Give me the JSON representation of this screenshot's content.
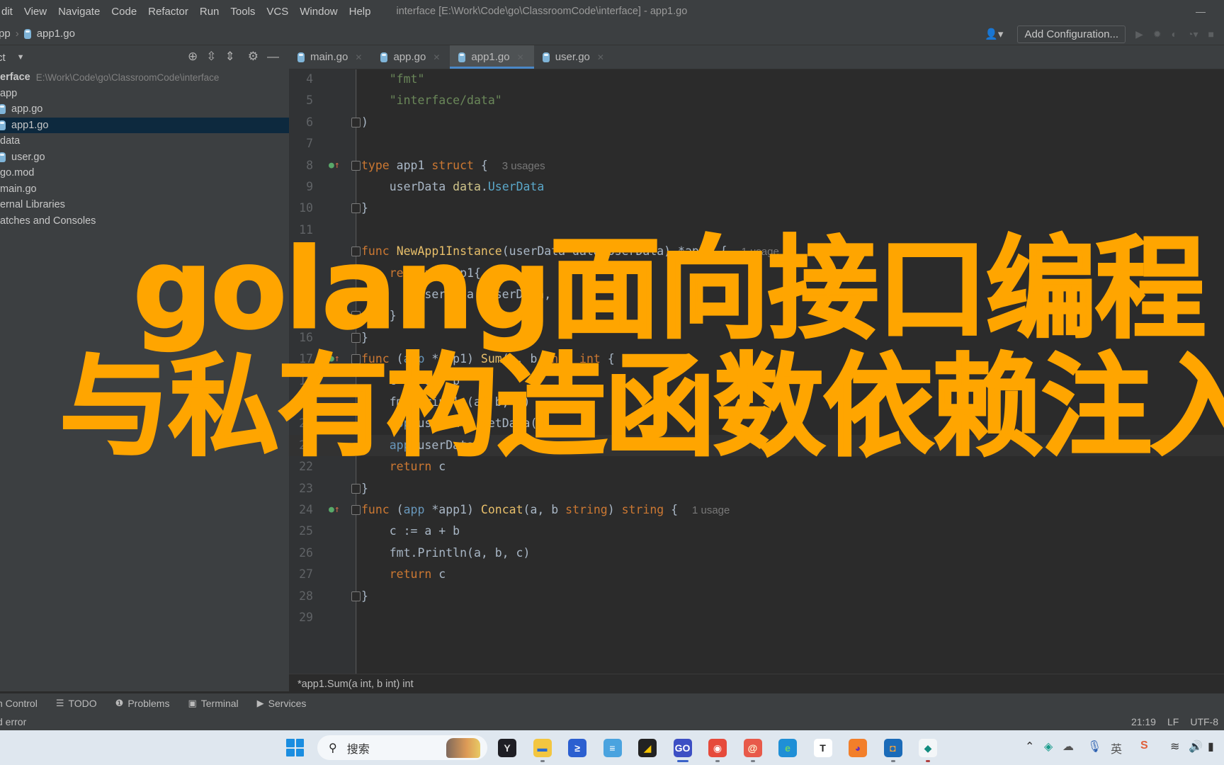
{
  "menubar": {
    "items": [
      "Edit",
      "View",
      "Navigate",
      "Code",
      "Refactor",
      "Run",
      "Tools",
      "VCS",
      "Window",
      "Help"
    ],
    "visible_items": [
      "dit",
      "View",
      "Navigate",
      "Code",
      "Refactor",
      "Run",
      "Tools",
      "VCS",
      "Window",
      "Help"
    ],
    "window_title": "interface [E:\\Work\\Code\\go\\ClassroomCode\\interface] - app1.go",
    "minimize": "—"
  },
  "navbar": {
    "breadcrumb": [
      "pp",
      "app1.go"
    ],
    "add_configuration": "Add Configuration...",
    "user_icon": "👤▾"
  },
  "project_panel": {
    "title": "ct",
    "tree": [
      {
        "label": "erface",
        "path": "E:\\Work\\Code\\go\\ClassroomCode\\interface",
        "indent": 0,
        "bold": true
      },
      {
        "label": "app",
        "indent": 0
      },
      {
        "label": "app.go",
        "indent": 0,
        "gofile": true
      },
      {
        "label": "app1.go",
        "indent": 0,
        "gofile": true,
        "selected": true
      },
      {
        "label": "data",
        "indent": 0
      },
      {
        "label": "user.go",
        "indent": 0,
        "gofile": true
      },
      {
        "label": "go.mod",
        "indent": 0
      },
      {
        "label": "main.go",
        "indent": 0
      },
      {
        "label": "ernal Libraries",
        "indent": 0
      },
      {
        "label": "atches and Consoles",
        "indent": 0
      }
    ]
  },
  "editor_tabs": [
    {
      "label": "main.go",
      "active": false
    },
    {
      "label": "app.go",
      "active": false
    },
    {
      "label": "app1.go",
      "active": true
    },
    {
      "label": "user.go",
      "active": false
    }
  ],
  "editor": {
    "lines": [
      {
        "n": "4",
        "html": "    <span class='str'>\"fmt\"</span>"
      },
      {
        "n": "5",
        "html": "    <span class='str'>\"interface/data\"</span>"
      },
      {
        "n": "6",
        "html": ")",
        "fold": true
      },
      {
        "n": "7",
        "html": ""
      },
      {
        "n": "8",
        "html": "<span class='kw'>type</span> app1 <span class='kw'>struct</span> {  <span class='hint'>3 usages</span>",
        "fold": true,
        "impl": true
      },
      {
        "n": "9",
        "html": "    userData <span class='pkg'>data</span>.<span class='ty'>UserData</span>"
      },
      {
        "n": "10",
        "html": "}",
        "fold": true
      },
      {
        "n": "11",
        "html": ""
      },
      {
        "n": "12",
        "html": "<span class='kw'>func</span> <span class='fnname'>NewApp1Instance</span>(userData data.UserData) *app1 {  <span class='hint'>1 usage</span>",
        "fold": true
      },
      {
        "n": "13",
        "html": "    <span class='kw'>return</span> &amp;app1{",
        "fold": true
      },
      {
        "n": "14",
        "html": "        userData: userData,"
      },
      {
        "n": "15",
        "html": "    }",
        "fold": true
      },
      {
        "n": "16",
        "html": "}",
        "fold": true
      },
      {
        "n": "17",
        "html": "<span class='kw'>func</span> (<span class='rcv'>app</span> *app1) <span class='fnname'>Sum</span>(a, b <span class='kw'>int</span>) <span class='kw'>int</span> {  <span class='hint'>1 usage</span>",
        "fold": true,
        "impl": true
      },
      {
        "n": "18",
        "html": "    c := a + b"
      },
      {
        "n": "19",
        "html": "    fmt.Println(a, b, c)"
      },
      {
        "n": "20",
        "html": "    <span class='rcv'>app</span>.userData.GetData()"
      },
      {
        "n": "21",
        "html": "    <span class='rcv'>app</span>.userData",
        "current": true
      },
      {
        "n": "22",
        "html": "    <span class='kw'>return</span> c"
      },
      {
        "n": "23",
        "html": "}",
        "fold": true
      },
      {
        "n": "24",
        "html": "<span class='kw'>func</span> (<span class='rcv'>app</span> *app1) <span class='fnname'>Concat</span>(a, b <span class='kw'>string</span>) <span class='kw'>string</span> {  <span class='hint'>1 usage</span>",
        "fold": true,
        "impl": true
      },
      {
        "n": "25",
        "html": "    c := a + b"
      },
      {
        "n": "26",
        "html": "    fmt.Println(a, b, c)"
      },
      {
        "n": "27",
        "html": "    <span class='kw'>return</span> c"
      },
      {
        "n": "28",
        "html": "}",
        "fold": true
      },
      {
        "n": "29",
        "html": ""
      }
    ],
    "breadcrumb": "*app1.Sum(a int, b int) int"
  },
  "tool_windows": [
    {
      "label": "n Control",
      "icon": ""
    },
    {
      "label": "TODO",
      "icon": "☰"
    },
    {
      "label": "Problems",
      "icon": "❶"
    },
    {
      "label": "Terminal",
      "icon": "▣"
    },
    {
      "label": "Services",
      "icon": "▶"
    }
  ],
  "statusbar": {
    "message": "d error",
    "position": "21:19",
    "line_ending": "LF",
    "encoding": "UTF-8"
  },
  "overlay": {
    "line1": "golang面向接口编程",
    "line2": "与私有构造函数依赖注入",
    "color": "#ffa500"
  },
  "taskbar": {
    "search_placeholder": "搜索",
    "apps": [
      "terminal-app",
      "file-explorer",
      "powershell",
      "notepad",
      "sticky-notes",
      "goland",
      "chrome",
      "app-swirl",
      "edge",
      "typora",
      "firefox",
      "virtualbox",
      "devtool"
    ],
    "tray": {
      "ime": "英"
    }
  }
}
